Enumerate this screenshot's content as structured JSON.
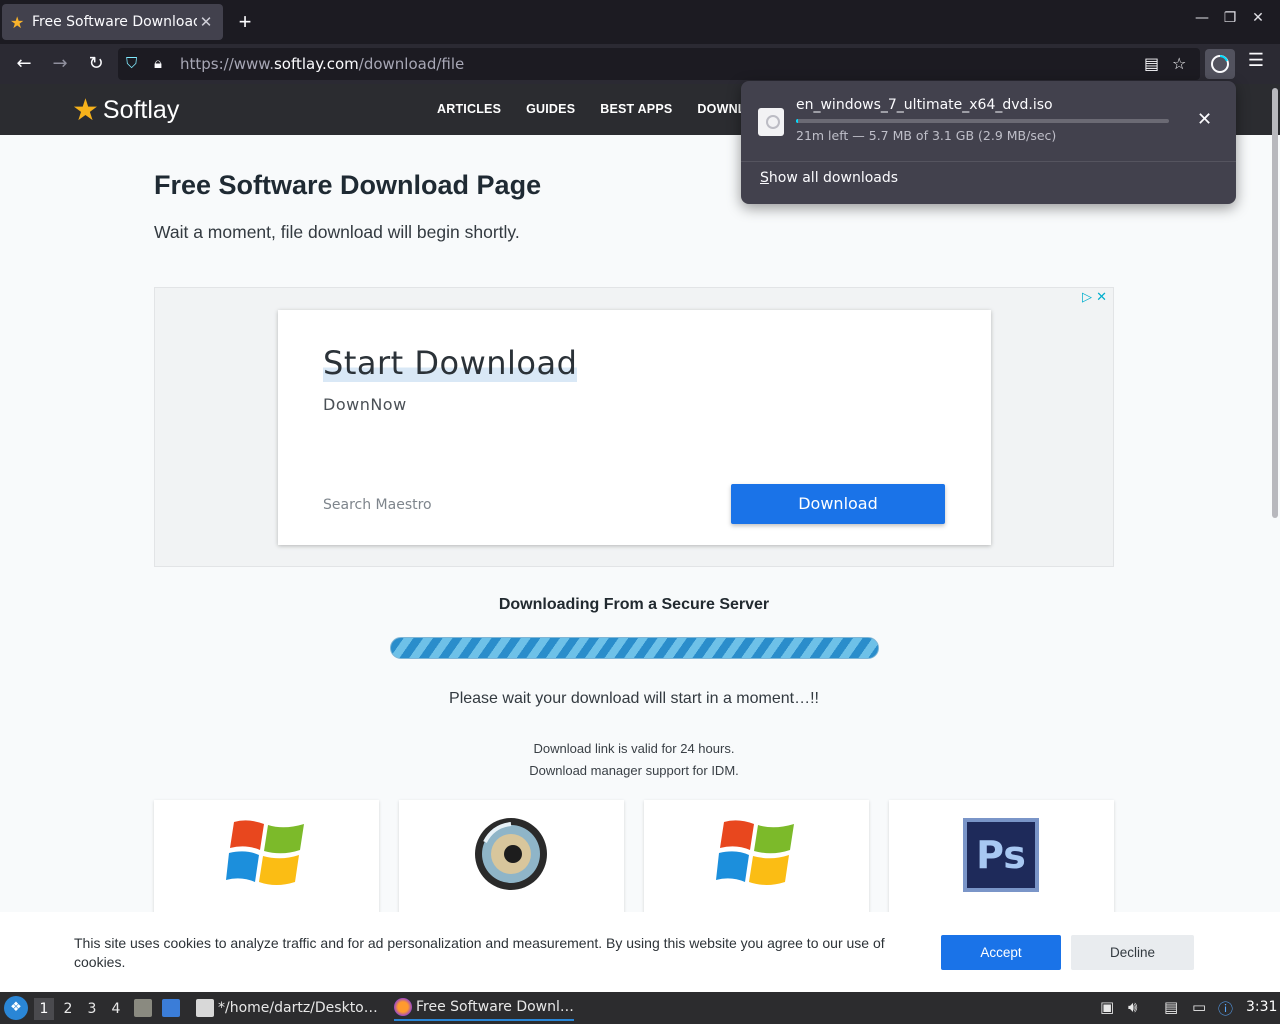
{
  "browser": {
    "tab": {
      "title": "Free Software Download"
    },
    "url": {
      "prefix": "https://www.",
      "host": "softlay.com",
      "path": "/download/file"
    }
  },
  "site": {
    "logo": "Softlay",
    "nav": [
      "ARTICLES",
      "GUIDES",
      "BEST APPS",
      "DOWNLO"
    ]
  },
  "page": {
    "title": "Free Software Download Page",
    "subtitle": "Wait a moment, file download will begin shortly.",
    "ad": {
      "title": "Start Download",
      "subtitle": "DownNow",
      "source": "Search Maestro",
      "button": "Download"
    },
    "secure_heading": "Downloading From a Secure Server",
    "wait_text": "Please wait your download will start in a moment…!!",
    "note1": "Download link is valid for 24 hours.",
    "note2": "Download manager support for IDM.",
    "cookie": {
      "text": "This site uses cookies to analyze traffic and for ad personalization and measurement. By using this website you agree to our use of cookies.",
      "accept": "Accept",
      "decline": "Decline"
    }
  },
  "downloads_panel": {
    "filename": "en_windows_7_ultimate_x64_dvd.iso",
    "status": "21m left — 5.7 MB of 3.1 GB (2.9 MB/sec)",
    "progress_fraction": 0.002,
    "show_all_prefix": "S",
    "show_all_rest": "how all downloads"
  },
  "taskbar": {
    "workspaces": [
      "1",
      "2",
      "3",
      "4"
    ],
    "apps": [
      {
        "label": "*/home/dartz/Deskto…"
      },
      {
        "label": "Free Software Downl…"
      }
    ],
    "clock": "3:31"
  }
}
